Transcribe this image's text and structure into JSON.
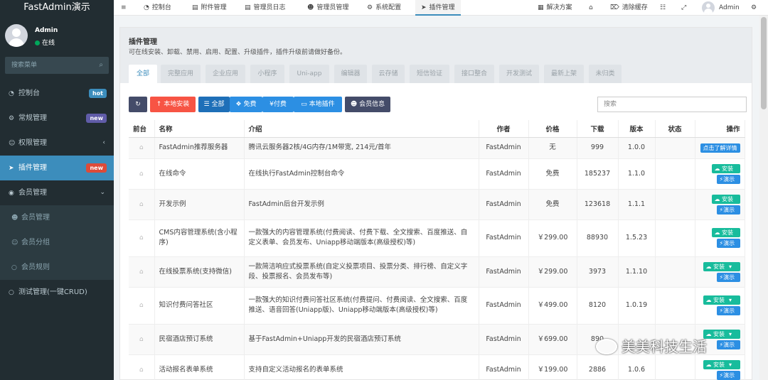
{
  "brand": "FastAdmin演示",
  "user": {
    "name": "Admin",
    "status": "在线"
  },
  "sidebar": {
    "search_placeholder": "搜索菜单",
    "items": [
      {
        "label": "控制台",
        "badge": "hot"
      },
      {
        "label": "常规管理",
        "badge": "new"
      },
      {
        "label": "权限管理",
        "badge": ""
      },
      {
        "label": "插件管理",
        "badge": "new"
      },
      {
        "label": "会员管理",
        "badge": ""
      },
      {
        "label": "会员管理"
      },
      {
        "label": "会员分组"
      },
      {
        "label": "会员规则"
      },
      {
        "label": "测试管理(一键CRUD)"
      }
    ]
  },
  "topbar": {
    "tabs": [
      "控制台",
      "附件管理",
      "管理员日志",
      "管理员管理",
      "系统配置",
      "插件管理"
    ],
    "right": {
      "solution": "解决方案",
      "clear_cache": "清除缓存",
      "user": "Admin"
    }
  },
  "panel": {
    "title": "插件管理",
    "desc": "可在线安装、卸载、禁用、启用、配置、升级插件，插件升级前请做好备份。",
    "tabs": [
      "全部",
      "完整应用",
      "企业应用",
      "小程序",
      "Uni-app",
      "编辑器",
      "云存储",
      "短信验证",
      "接口整合",
      "开发测试",
      "最新上架",
      "未归类"
    ]
  },
  "toolbar": {
    "local_install": "本地安装",
    "all": "全部",
    "free": "免费",
    "paid": "付费",
    "local_plugins": "本地插件",
    "member_info": "会员信息",
    "search_placeholder": "搜索"
  },
  "table": {
    "headers": [
      "前台",
      "名称",
      "介绍",
      "作者",
      "价格",
      "下载",
      "版本",
      "状态",
      "操作"
    ],
    "rows": [
      {
        "name": "FastAdmin推荐服务器",
        "intro": "腾讯云服务器2核/4G内存/1M带宽, 214元/首年",
        "author": "FastAdmin",
        "price": "无",
        "downloads": "999",
        "version": "1.0.0",
        "action": "点击了解详情"
      },
      {
        "name": "在线命令",
        "intro": "在线执行FastAdmin控制台命令",
        "author": "FastAdmin",
        "price": "免费",
        "downloads": "185237",
        "version": "1.1.0",
        "action": "安装",
        "demo": "演示"
      },
      {
        "name": "开发示例",
        "intro": "FastAdmin后台开发示例",
        "author": "FastAdmin",
        "price": "免费",
        "downloads": "123618",
        "version": "1.1.1",
        "action": "安装",
        "demo": "演示"
      },
      {
        "name": "CMS内容管理系统(含小程序)",
        "intro": "一款强大的内容管理系统(付费阅读、付费下载、全文搜索、百度推送、自定义表单、会员发布、Uniapp移动端版本(高级授权)等)",
        "author": "FastAdmin",
        "price": "￥299.00",
        "downloads": "88930",
        "version": "1.5.23",
        "action": "安装",
        "demo": "演示"
      },
      {
        "name": "在线投票系统(支持微信)",
        "intro": "一款简洁响应式投票系统(自定义投票项目、投票分类、排行榜、自定义字段、投票报名、会员发布等)",
        "author": "FastAdmin",
        "price": "￥299.00",
        "downloads": "3973",
        "version": "1.1.10",
        "action": "安装",
        "demo": "演示"
      },
      {
        "name": "知识付费问答社区",
        "intro": "一款强大的知识付费问答社区系统(付费提问、付费阅读、全文搜索、百度推送、语音回答(Uniapp版)、Uniapp移动端版本(高级授权)等)",
        "author": "FastAdmin",
        "price": "￥499.00",
        "downloads": "8120",
        "version": "1.0.19",
        "action": "安装",
        "demo": "演示"
      },
      {
        "name": "民宿酒店预订系统",
        "intro": "基于FastAdmin+Uniapp开发的民宿酒店预订系统",
        "author": "FastAdmin",
        "price": "￥699.00",
        "downloads": "890",
        "version": "",
        "action": "安装",
        "demo": "演示"
      },
      {
        "name": "活动报名表单系统",
        "intro": "支持自定义活动报名的表单系统",
        "author": "FastAdmin",
        "price": "￥199.00",
        "downloads": "2886",
        "version": "1.0.6",
        "action": "安装",
        "demo": "演示"
      }
    ]
  },
  "watermark": "美美科技生活",
  "colors": {
    "sidebar": "#222d32",
    "accent": "#3c8dbc",
    "danger": "#f75444",
    "success": "#18bc9c",
    "primary": "#2c8fe3"
  }
}
